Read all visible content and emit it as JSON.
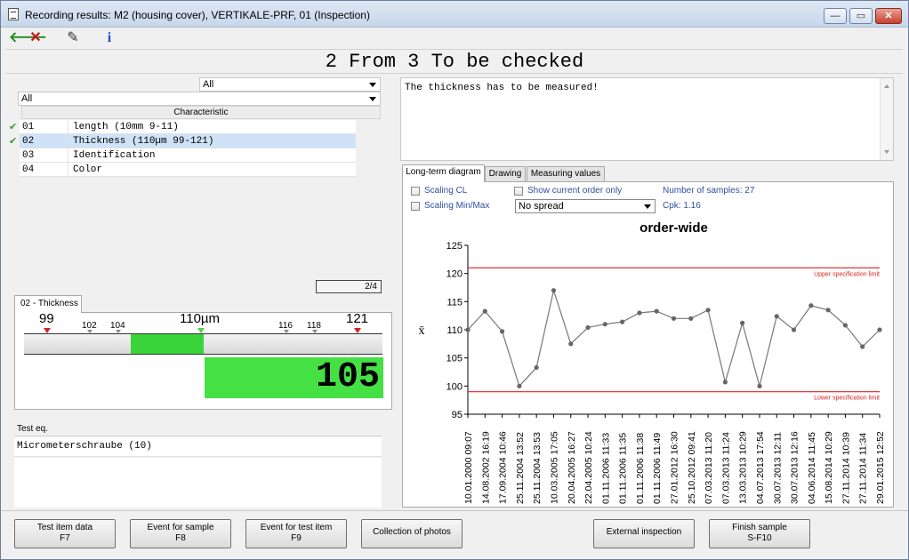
{
  "window": {
    "title": "Recording results: M2 (housing cover), VERTIKALE-PRF, 01 (Inspection)",
    "min_label": "—",
    "max_label": "▭",
    "close_label": "✕"
  },
  "toolbar": {
    "back_glyph": "🡐",
    "cancel_glyph": "✕",
    "edit_glyph": "✎",
    "info_glyph": "i"
  },
  "headline": "2 From 3 To be checked",
  "filters": {
    "top_value": "All",
    "second_value": "All",
    "column_header": "Characteristic"
  },
  "characteristics": [
    {
      "check": "✔",
      "num": "01",
      "name": "length (10mm 9-11)"
    },
    {
      "check": "✔",
      "num": "02",
      "name": "Thickness (110µm 99-121)"
    },
    {
      "check": "",
      "num": "03",
      "name": "Identification"
    },
    {
      "check": "",
      "num": "04",
      "name": "Color"
    }
  ],
  "counter": "2/4",
  "measure": {
    "tab": "02 - Thickness",
    "ticks": {
      "t99": "99",
      "t102": "102",
      "t104": "104",
      "t110": "110µm",
      "t116": "116",
      "t118": "118",
      "t121": "121"
    },
    "value": "105"
  },
  "test_eq": {
    "header": "Test eq.",
    "value": "Micrometerschraube (10)"
  },
  "note": "The thickness has to be measured!",
  "tabs": [
    "Long-term diagram",
    "Drawing",
    "Measuring values"
  ],
  "options": {
    "scaling_cl": "Scaling CL",
    "scaling_minmax": "Scaling Min/Max",
    "show_current": "Show current order only",
    "spread": "No spread",
    "samples": "Number of samples: 27",
    "cpk": "Cpk: 1.16"
  },
  "chart_data": {
    "type": "line",
    "title": "order-wide",
    "ylabel": "x̄",
    "ylim": [
      95,
      125
    ],
    "yticks": [
      95,
      100,
      105,
      110,
      115,
      120,
      125
    ],
    "x": [
      "10.01.2000 09:07",
      "14.08.2002 16:19",
      "17.09.2004 10:46",
      "25.11.2004 13:52",
      "25.11.2004 13:53",
      "10.03.2005 17:05",
      "20.04.2005 16:27",
      "22.04.2005 10:24",
      "01.11.2006 11:33",
      "01.11.2006 11:35",
      "01.11.2006 11:38",
      "01.11.2006 11:49",
      "27.01.2012 16:30",
      "25.10.2012 09:41",
      "07.03.2013 11:20",
      "07.03.2013 11:24",
      "13.03.2013 10:29",
      "04.07.2013 17:54",
      "30.07.2013 12:11",
      "30.07.2013 12:16",
      "04.06.2014 11:45",
      "15.08.2014 10:29",
      "27.11.2014 10:39",
      "27.11.2014 11:34",
      "29.01.2015 12:52"
    ],
    "series": [
      {
        "values": [
          110,
          113.3,
          109.7,
          100,
          103.3,
          117,
          107.5,
          110.4,
          111,
          111.4,
          113,
          113.3,
          112,
          112,
          113.5,
          100.7,
          111.2,
          100,
          112.4,
          110,
          114.3,
          113.5,
          110.8,
          107,
          110
        ]
      }
    ],
    "limits": [
      {
        "label": "Upper specification limit",
        "value": 121,
        "color": "#e02020"
      },
      {
        "label": "Lower specification limit",
        "value": 99,
        "color": "#e02020"
      }
    ],
    "line_color": "#777777",
    "grid": false
  },
  "buttons": {
    "test_item_data": "Test item data",
    "f7": "F7",
    "event_sample": "Event for sample",
    "f8": "F8",
    "event_test_item": "Event for test item",
    "f9": "F9",
    "photos": "Collection of photos",
    "external": "External inspection",
    "finish": "Finish sample",
    "sf10": "S-F10"
  }
}
